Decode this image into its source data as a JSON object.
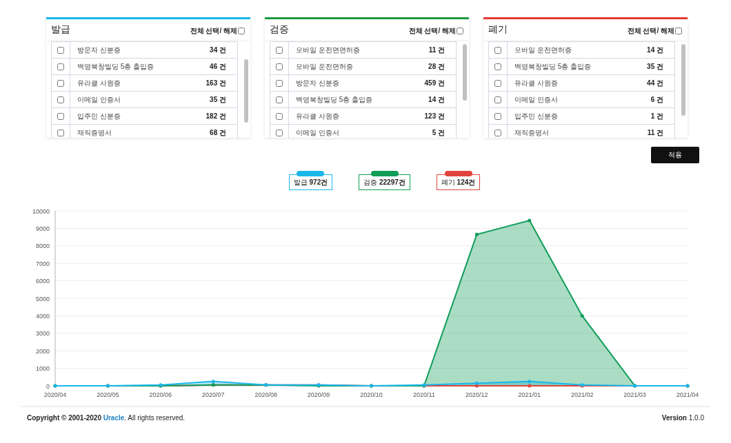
{
  "panels": [
    {
      "title": "발급",
      "color": "#1ab7ea",
      "select_all": {
        "label": "전체 선택/ 해제",
        "checked": false
      },
      "items": [
        {
          "label": "방문자 신분증",
          "count": "34 건",
          "checked": false
        },
        {
          "label": "백영북창빌딩 5층 출입증",
          "count": "46 건",
          "checked": false
        },
        {
          "label": "유라클 사원증",
          "count": "163 건",
          "checked": false
        },
        {
          "label": "이메일 인증서",
          "count": "35 건",
          "checked": false
        },
        {
          "label": "입주민 신분증",
          "count": "182 건",
          "checked": false
        },
        {
          "label": "재직증명서",
          "count": "68 건",
          "checked": false
        }
      ]
    },
    {
      "title": "검증",
      "color": "#1d9b3f",
      "select_all": {
        "label": "전체 선택/ 해제",
        "checked": false
      },
      "items": [
        {
          "label": "모바일 운전면면허증",
          "count": "11 건",
          "checked": false
        },
        {
          "label": "모바일 운전면허증",
          "count": "28 건",
          "checked": false
        },
        {
          "label": "방문자 신분증",
          "count": "459 건",
          "checked": false
        },
        {
          "label": "백영북창빌딩 5층 출입증",
          "count": "14 건",
          "checked": false
        },
        {
          "label": "유라클 사원증",
          "count": "123 건",
          "checked": false
        },
        {
          "label": "이메일 인증서",
          "count": "5 건",
          "checked": false
        }
      ]
    },
    {
      "title": "폐기",
      "color": "#e53935",
      "select_all": {
        "label": "전체 선택/ 해제",
        "checked": false
      },
      "items": [
        {
          "label": "모바일 운전면허증",
          "count": "14 건",
          "checked": false
        },
        {
          "label": "백영북창빌딩 5층 출입증",
          "count": "35 건",
          "checked": false
        },
        {
          "label": "유라클 사원증",
          "count": "44 건",
          "checked": false
        },
        {
          "label": "이메일 인증서",
          "count": "6 건",
          "checked": false
        },
        {
          "label": "입주민 신분증",
          "count": "1 건",
          "checked": false
        },
        {
          "label": "재직증명서",
          "count": "11 건",
          "checked": false
        }
      ]
    }
  ],
  "apply_button": "적용",
  "legend_totals": [
    "972건",
    "22297건",
    "124건"
  ],
  "chart_data": {
    "type": "area",
    "grid": true,
    "categories": [
      "2020/04",
      "2020/05",
      "2020/06",
      "2020/07",
      "2020/08",
      "2020/09",
      "2020/10",
      "2020/11",
      "2020/12",
      "2021/01",
      "2021/02",
      "2021/03",
      "2021/04"
    ],
    "ylim": [
      0,
      10000
    ],
    "yticks": [
      0,
      1000,
      2000,
      3000,
      4000,
      5000,
      6000,
      7000,
      8000,
      9000,
      10000
    ],
    "series": [
      {
        "name": "발급",
        "color": "#1ab7ea",
        "values": [
          0,
          0,
          50,
          250,
          50,
          50,
          0,
          50,
          150,
          250,
          50,
          0,
          0
        ]
      },
      {
        "name": "검증",
        "color": "#0f9d58",
        "values": [
          0,
          0,
          0,
          50,
          50,
          0,
          0,
          0,
          8650,
          9450,
          4000,
          0,
          0
        ]
      },
      {
        "name": "폐기",
        "color": "#e0443c",
        "values": [
          0,
          0,
          0,
          50,
          50,
          50,
          0,
          0,
          0,
          0,
          0,
          0,
          0
        ]
      }
    ]
  },
  "footer": {
    "copyright_before": "Copyright © 2001-2020",
    "company": "Uracle",
    "copyright_after": ". All rights reserved.",
    "version_label": "Version",
    "version": "1.0.0"
  }
}
